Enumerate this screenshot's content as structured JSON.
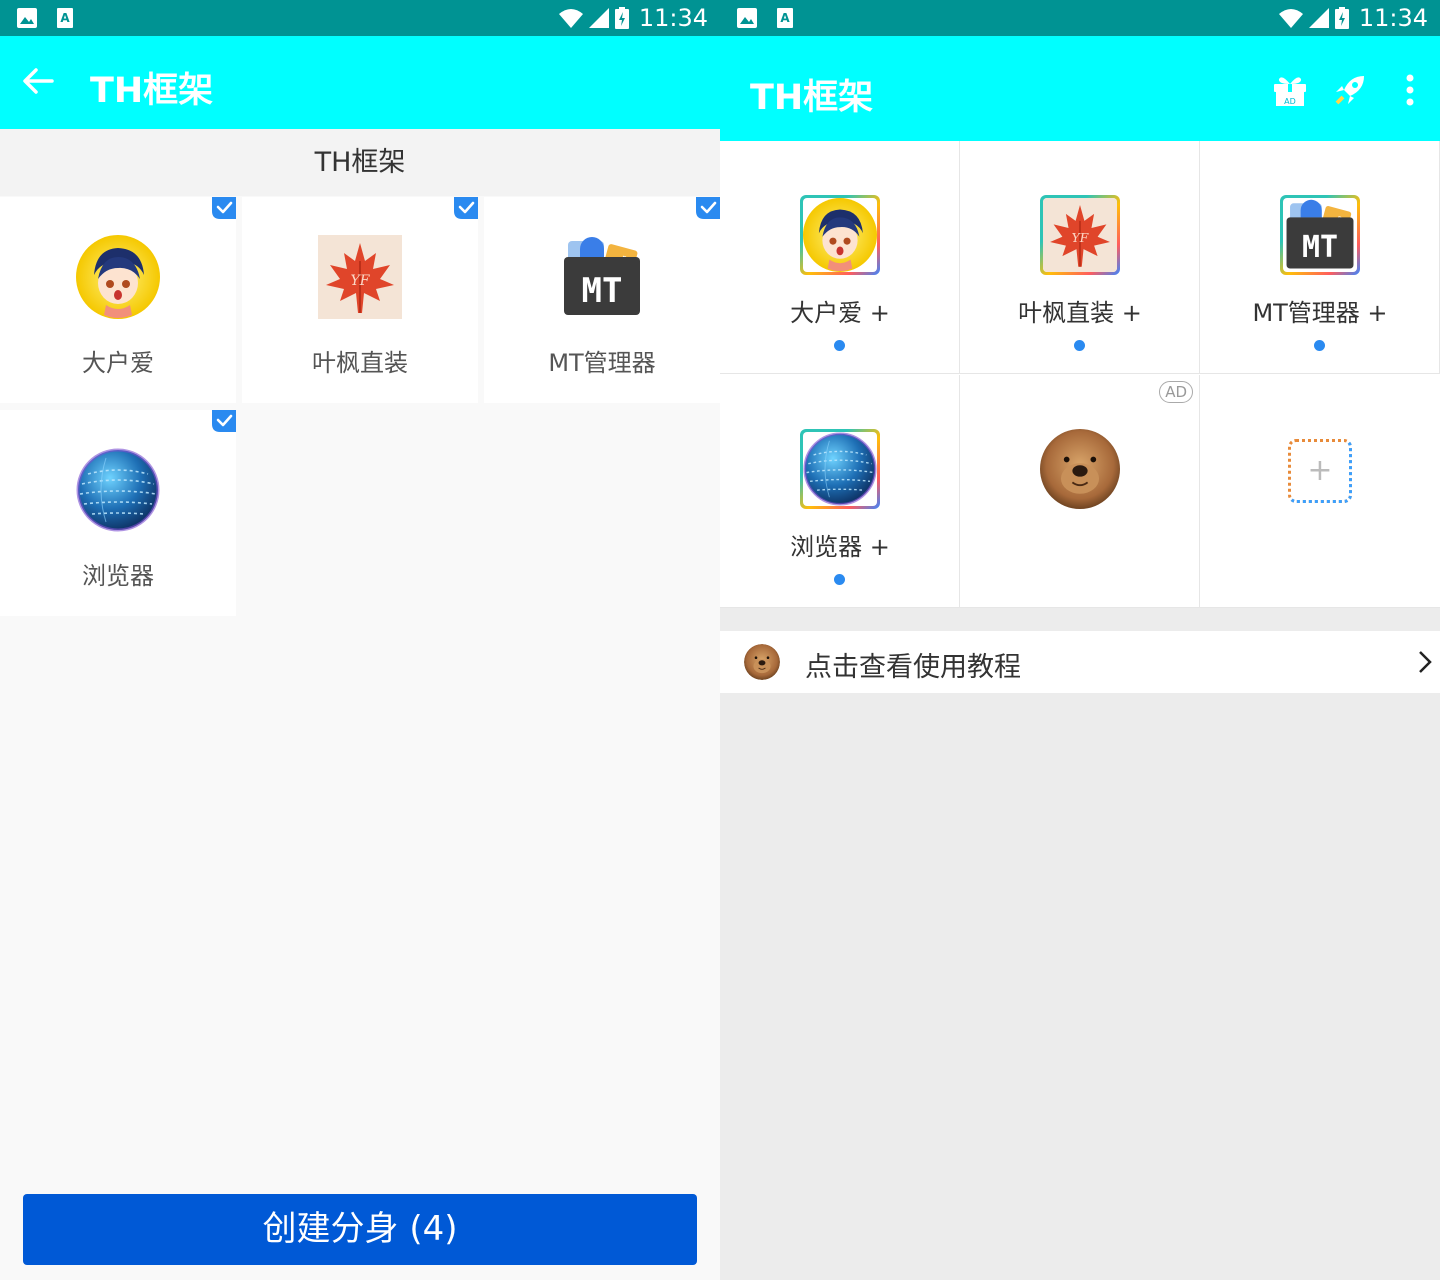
{
  "status_bar": {
    "time": "11:34"
  },
  "left": {
    "title": "TH框架",
    "section_header": "TH框架",
    "apps": [
      {
        "label": "大户爱",
        "checked": true
      },
      {
        "label": "叶枫直装",
        "checked": true
      },
      {
        "label": "MT管理器",
        "checked": true
      },
      {
        "label": "浏览器",
        "checked": true
      }
    ],
    "create_button": "创建分身 (4)"
  },
  "right": {
    "title": "TH框架",
    "grid": [
      {
        "label": "大户爱 +"
      },
      {
        "label": "叶枫直装 +"
      },
      {
        "label": "MT管理器 +"
      },
      {
        "label": "浏览器 +"
      }
    ],
    "ad_badge": "AD",
    "gift_badge": "AD",
    "tutorial": "点击查看使用教程"
  },
  "colors": {
    "status_bar": "#009393",
    "app_bar": "#00ffff",
    "button": "#0059d6",
    "dot": "#2a8af0",
    "check": "#2a8af0"
  }
}
